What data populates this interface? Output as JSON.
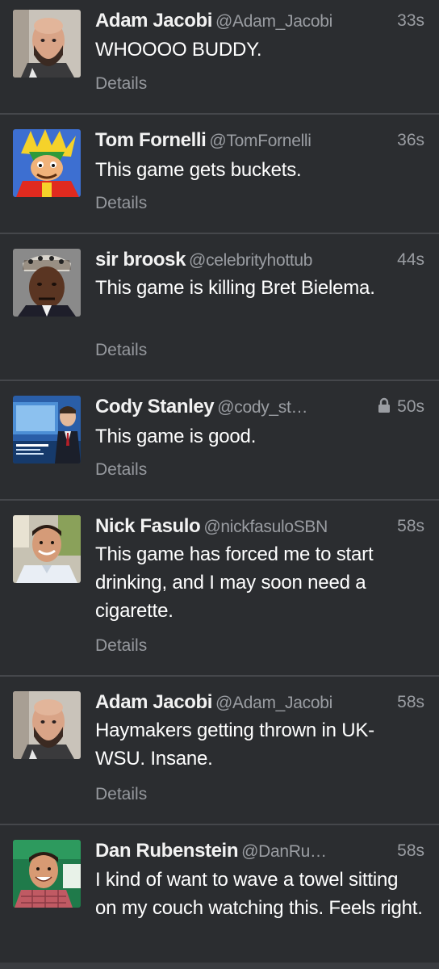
{
  "tweets": [
    {
      "name": "Adam Jacobi",
      "handle": "@Adam_Jacobi",
      "time": "33s",
      "text": "WHOOOO BUDDY.",
      "details": "Details",
      "avatar": "bald-bearded-man-avatar"
    },
    {
      "name": "Tom Fornelli",
      "handle": "@TomFornelli",
      "time": "36s",
      "text": "This game gets buckets.",
      "details": "Details",
      "avatar": "cartoon-character-avatar"
    },
    {
      "name": "sir broosk",
      "handle": "@celebrityhottub",
      "time": "44s",
      "text": "This game is killing Bret Bielema.",
      "details": "Details",
      "avatar": "man-with-hat-avatar"
    },
    {
      "name": "Cody Stanley",
      "handle": "@cody_st…",
      "time": "50s",
      "protected": true,
      "text": "This game is good.",
      "details": "Details",
      "avatar": "tv-anchor-avatar"
    },
    {
      "name": "Nick Fasulo",
      "handle": "@nickfasuloSBN",
      "time": "58s",
      "text": "This game has forced me to start drinking, and I may soon need a cigarette.",
      "details": "Details",
      "avatar": "smiling-man-avatar"
    },
    {
      "name": "Adam Jacobi",
      "handle": "@Adam_Jacobi",
      "time": "58s",
      "text": "Haymakers getting thrown in UK-WSU. Insane.",
      "details": "Details",
      "avatar": "bald-bearded-man-avatar"
    },
    {
      "name": "Dan Rubenstein",
      "handle": "@DanRu…",
      "time": "58s",
      "text": "I kind of want to wave a towel sitting on my couch watching this. Feels right.",
      "details": "",
      "avatar": "smiling-man-green-bg-avatar"
    }
  ]
}
